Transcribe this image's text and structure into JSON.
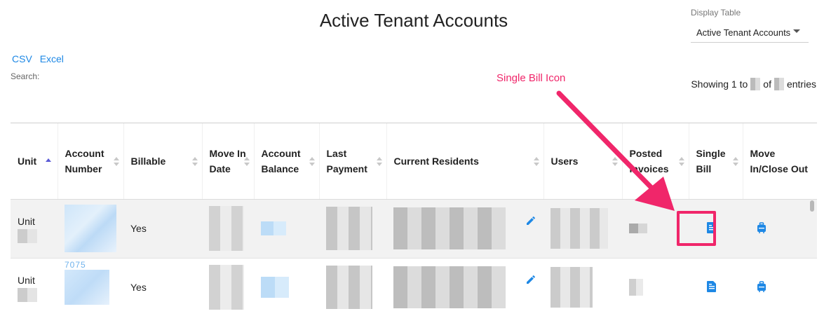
{
  "page": {
    "title": "Active Tenant Accounts"
  },
  "display_table": {
    "label": "Display Table",
    "selected": "Active Tenant Accounts"
  },
  "export": {
    "csv": "CSV",
    "excel": "Excel"
  },
  "search": {
    "label": "Search:"
  },
  "pagination": {
    "prefix": "Showing 1 to",
    "of": "of",
    "suffix": "entries"
  },
  "annotation": {
    "text": "Single Bill Icon",
    "color": "#f0266a"
  },
  "table": {
    "headers": [
      "Unit",
      "Account Number",
      "Billable",
      "Move In Date",
      "Account Balance",
      "Last Payment",
      "Current Residents",
      "Users",
      "Posted Invoices",
      "Single Bill",
      "Move In/Close Out"
    ],
    "rows": [
      {
        "unit": "Unit",
        "billable": "Yes"
      },
      {
        "unit": "Unit",
        "account_number_partial": "7075",
        "billable": "Yes"
      }
    ]
  },
  "colors": {
    "link": "#1e88e5",
    "icon": "#1e88e5",
    "annotation": "#f0266a"
  },
  "icons": {
    "edit": "pencil-icon",
    "single_bill": "document-icon",
    "close_out": "suitcase-icon",
    "sort_asc": "sort-ascending-icon",
    "sort": "sort-icon",
    "dropdown": "caret-down-icon"
  }
}
